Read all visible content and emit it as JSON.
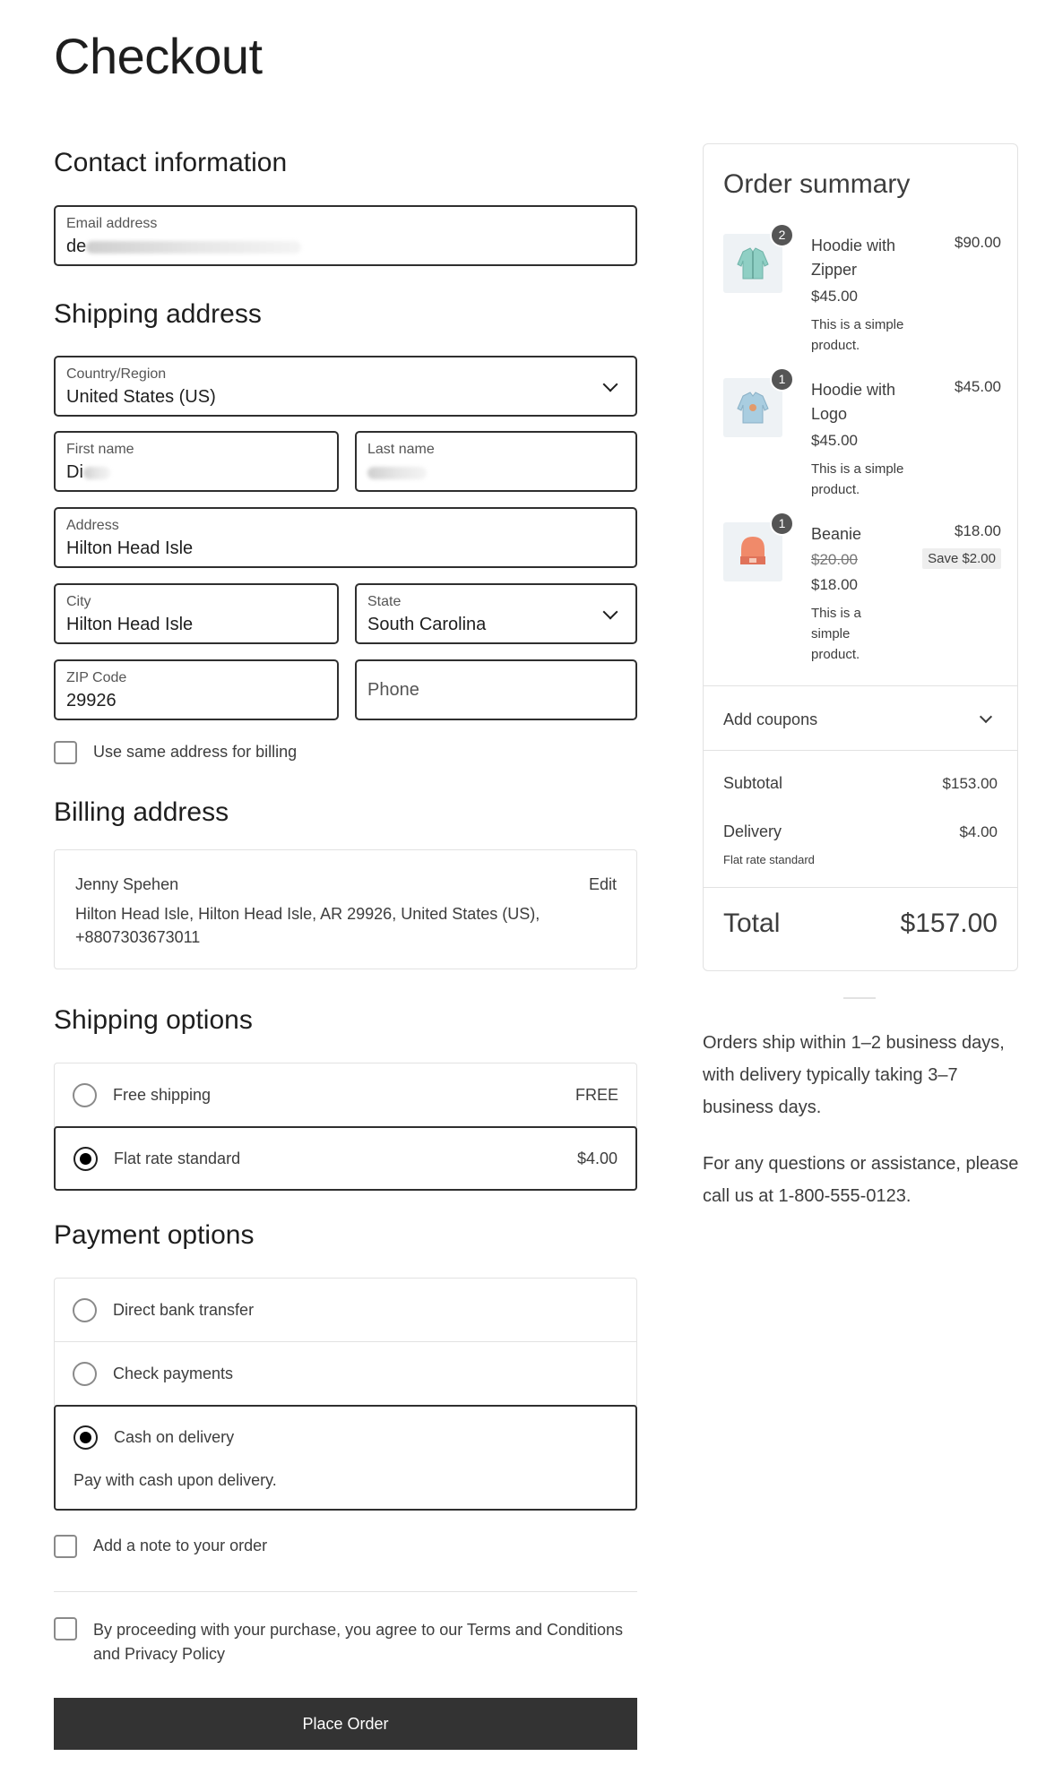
{
  "page": {
    "title": "Checkout"
  },
  "contact": {
    "heading": "Contact information",
    "email_label": "Email address",
    "email_value": "de"
  },
  "shipping_address": {
    "heading": "Shipping address",
    "country_label": "Country/Region",
    "country_value": "United States (US)",
    "first_name_label": "First name",
    "first_name_value": "Di",
    "last_name_label": "Last name",
    "address_label": "Address",
    "address_value": "Hilton Head Isle",
    "city_label": "City",
    "city_value": "Hilton Head Isle",
    "state_label": "State",
    "state_value": "South Carolina",
    "zip_label": "ZIP Code",
    "zip_value": "29926",
    "phone_placeholder": "Phone",
    "same_billing_label": "Use same address for billing"
  },
  "billing": {
    "heading": "Billing address",
    "name": "Jenny Spehen",
    "address": "Hilton Head Isle, Hilton Head Isle, AR 29926, United States (US), +8807303673011",
    "edit_label": "Edit"
  },
  "shipping_options": {
    "heading": "Shipping options",
    "options": [
      {
        "label": "Free shipping",
        "price": "FREE",
        "selected": false
      },
      {
        "label": "Flat rate standard",
        "price": "$4.00",
        "selected": true
      }
    ]
  },
  "payment_options": {
    "heading": "Payment options",
    "options": [
      {
        "label": "Direct bank transfer",
        "selected": false
      },
      {
        "label": "Check payments",
        "selected": false
      },
      {
        "label": "Cash on delivery",
        "selected": true,
        "description": "Pay with cash upon delivery."
      }
    ]
  },
  "order_note": {
    "label": "Add a note to your order"
  },
  "terms": {
    "label": "By proceeding with your purchase, you agree to our Terms and Conditions and Privacy Policy"
  },
  "place_order": {
    "label": "Place Order"
  },
  "summary": {
    "heading": "Order summary",
    "items": [
      {
        "name": "Hoodie with Zipper",
        "qty": "2",
        "line_total": "$90.00",
        "unit_price": "$45.00",
        "description": "This is a simple product.",
        "icon": "hoodie-zipper-icon",
        "color": "#8fcfc4"
      },
      {
        "name": "Hoodie with Logo",
        "qty": "1",
        "line_total": "$45.00",
        "unit_price": "$45.00",
        "description": "This is a simple product.",
        "icon": "hoodie-logo-icon",
        "color": "#a9cde0"
      },
      {
        "name": "Beanie",
        "qty": "1",
        "line_total": "$18.00",
        "original_price": "$20.00",
        "unit_price": "$18.00",
        "save": "Save $2.00",
        "description": "This is a simple product.",
        "icon": "beanie-icon",
        "color": "#f08a6a"
      }
    ],
    "coupons_label": "Add coupons",
    "subtotal_label": "Subtotal",
    "subtotal_value": "$153.00",
    "delivery_label": "Delivery",
    "delivery_value": "$4.00",
    "delivery_method": "Flat rate standard",
    "total_label": "Total",
    "total_value": "$157.00"
  },
  "notes": {
    "shipping_note": "Orders ship within 1–2 business days, with delivery typically taking 3–7 business days.",
    "contact_note": "For any questions or assistance, please call us at 1-800-555-0123."
  }
}
